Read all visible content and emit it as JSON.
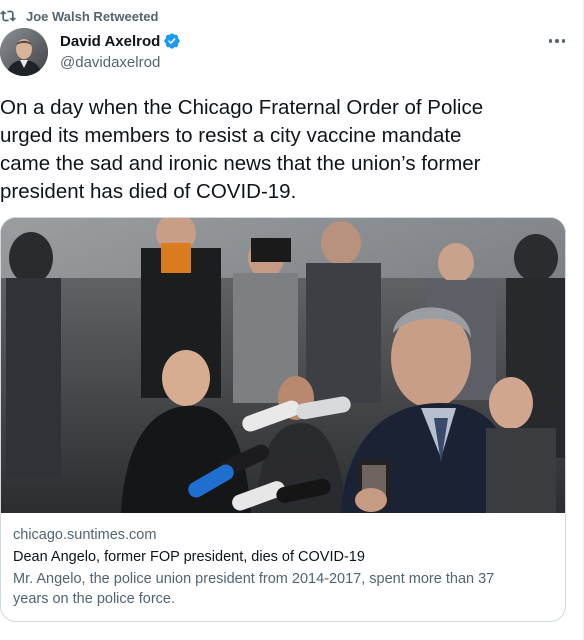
{
  "retweet": {
    "label": "Joe Walsh Retweeted",
    "icon": "retweet-icon"
  },
  "author": {
    "display_name": "David Axelrod",
    "handle": "@davidaxelrod",
    "verified": true,
    "verified_color": "#1d9bf0"
  },
  "more_menu": {
    "icon": "more-dots-icon"
  },
  "tweet": {
    "text": "On a day when the Chicago Fraternal Order of Police\nurged its members to resist a city vaccine mandate\ncame the sad and ironic news that the union’s former\npresident has died of COVID-19."
  },
  "link_card": {
    "domain": "chicago.suntimes.com",
    "title": "Dean Angelo, former FOP president, dies of COVID-19",
    "description": "Mr. Angelo, the police union president from 2014-2017, spent more than 37\nyears on the police force."
  },
  "colors": {
    "primary_text": "#0f1419",
    "secondary_text": "#536471",
    "border": "#cfd9de",
    "accent": "#1d9bf0"
  }
}
